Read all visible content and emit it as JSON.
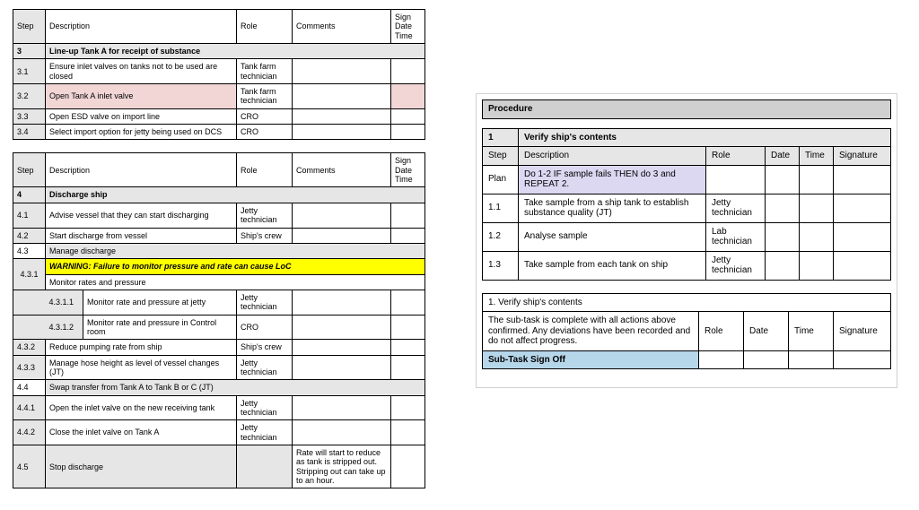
{
  "left": {
    "headers": {
      "step": "Step",
      "desc": "Description",
      "role": "Role",
      "comments": "Comments",
      "sign": "Sign\nDate\nTime"
    },
    "t1": {
      "section": {
        "num": "3",
        "title": "Line-up Tank A for receipt of substance"
      },
      "rows": [
        {
          "num": "3.1",
          "desc": "Ensure inlet valves on tanks not to be used are closed",
          "role": "Tank farm technician"
        },
        {
          "num": "3.2",
          "desc": "Open Tank A inlet valve",
          "role": "Tank farm technician",
          "pink": true
        },
        {
          "num": "3.3",
          "desc": "Open ESD valve on import line",
          "role": "CRO"
        },
        {
          "num": "3.4",
          "desc": "Select import option for jetty being used on DCS",
          "role": "CRO"
        }
      ]
    },
    "t2": {
      "section4": {
        "num": "4",
        "title": "Discharge ship"
      },
      "r41": {
        "num": "4.1",
        "desc": "Advise vessel that they can start discharging",
        "role": "Jetty technician"
      },
      "r42": {
        "num": "4.2",
        "desc": "Start discharge from vessel",
        "role": "Ship's crew"
      },
      "r43": {
        "num": "4.3",
        "desc": "Manage discharge"
      },
      "w431": {
        "num": "4.3.1",
        "warn": "WARNING: Failure to monitor pressure and rate can cause LoC",
        "desc": "Monitor rates and pressure"
      },
      "r4311": {
        "num": "4.3.1.1",
        "desc": "Monitor rate and pressure at jetty",
        "role": "Jetty technician"
      },
      "r4312": {
        "num": "4.3.1.2",
        "desc": "Monitor rate and pressure in Control room",
        "role": "CRO"
      },
      "r432": {
        "num": "4.3.2",
        "desc": "Reduce pumping rate from ship",
        "role": "Ship's crew"
      },
      "r433": {
        "num": "4.3.3",
        "desc": "Manage hose height as level of vessel changes (JT)",
        "role": "Jetty technician"
      },
      "r44": {
        "num": "4.4",
        "desc": "Swap transfer from Tank A to Tank B or C (JT)"
      },
      "r441": {
        "num": "4.4.1",
        "desc": "Open the inlet valve on the new receiving tank",
        "role": "Jetty technician"
      },
      "r442": {
        "num": "4.4.2",
        "desc": "Close the inlet valve on Tank A",
        "role": "Jetty technician"
      },
      "r45": {
        "num": "4.5",
        "desc": "Stop discharge",
        "comment": "Rate will start to reduce as tank is stripped out.   Stripping out can take up to an hour."
      }
    }
  },
  "right": {
    "procHeader": "Procedure",
    "t1": {
      "section": {
        "num": "1",
        "title": "Verify ship's contents"
      },
      "headers": {
        "step": "Step",
        "desc": "Description",
        "role": "Role",
        "date": "Date",
        "time": "Time",
        "sig": "Signature"
      },
      "plan": {
        "label": "Plan",
        "text": "Do 1-2 IF sample fails THEN do 3 and REPEAT 2."
      },
      "rows": [
        {
          "num": "1.1",
          "desc": "Take sample from a ship tank   to establish substance quality (JT)",
          "role": "Jetty technician"
        },
        {
          "num": "1.2",
          "desc": "Analyse sample",
          "role": "Lab technician"
        },
        {
          "num": "1.3",
          "desc": "Take sample from each tank on ship",
          "role": "Jetty technician"
        }
      ]
    },
    "signoff": {
      "title": "1. Verify ship's contents",
      "text": "The sub-task is complete with all actions above confirmed. Any deviations have been recorded and do not affect progress.",
      "label": "Sub-Task Sign Off",
      "role": "Role",
      "date": "Date",
      "time": "Time",
      "sig": "Signature"
    }
  }
}
